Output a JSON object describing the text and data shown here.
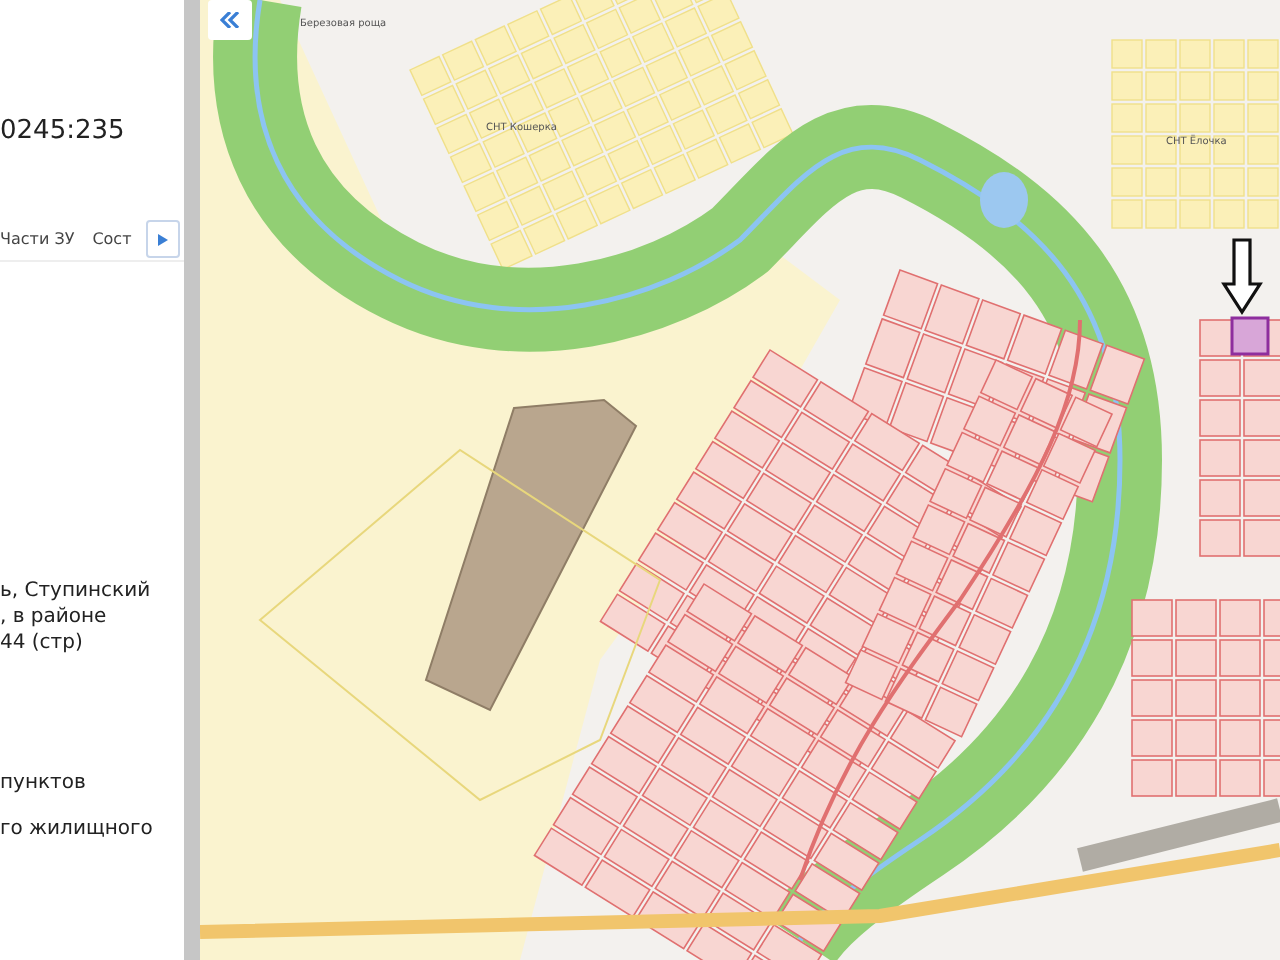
{
  "panel": {
    "title": "0245:235",
    "tabs": [
      {
        "label": "Части ЗУ",
        "selected": false
      },
      {
        "label": "Сост",
        "selected": false
      }
    ],
    "address_lines": [
      "ь, Ступинский",
      ", в районе",
      "44 (стр)"
    ],
    "lines": [
      "пунктов",
      "го жилищного"
    ]
  },
  "map": {
    "labels": [
      "Березовая роща",
      "СНТ Кошерка",
      "СНТ Ёлочка"
    ]
  }
}
